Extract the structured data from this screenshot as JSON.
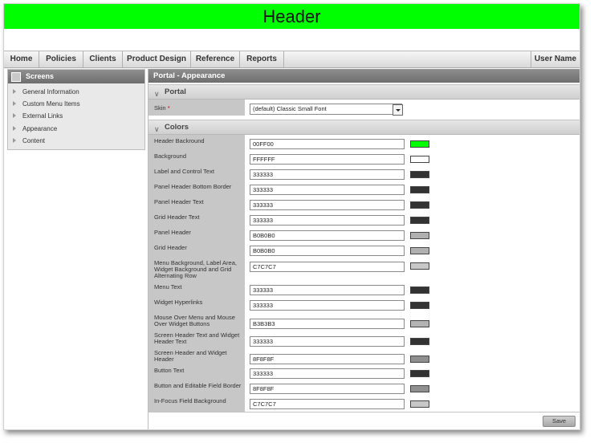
{
  "banner": {
    "title": "Header"
  },
  "nav": {
    "items": [
      "Home",
      "Policies",
      "Clients",
      "Product Design",
      "Reference",
      "Reports"
    ],
    "user": "User Name"
  },
  "sidebar": {
    "title": "Screens",
    "items": [
      "General Information",
      "Custom Menu Items",
      "External Links",
      "Appearance",
      "Content"
    ]
  },
  "main": {
    "title": "Portal - Appearance",
    "portal_section": "Portal",
    "skin_label": "Skin",
    "skin_value": "(default) Classic Small Font",
    "colors_section": "Colors",
    "save_label": "Save"
  },
  "colors": [
    {
      "label": "Header Backround",
      "value": "00FF00",
      "swatch": "#00ff00"
    },
    {
      "label": "Background",
      "value": "FFFFFF",
      "swatch": "#ffffff"
    },
    {
      "label": "Label and Control Text",
      "value": "333333",
      "swatch": "#333333"
    },
    {
      "label": "Panel Header Bottom Border",
      "value": "333333",
      "swatch": "#333333"
    },
    {
      "label": "Panel Header Text",
      "value": "333333",
      "swatch": "#333333"
    },
    {
      "label": "Grid Header Text",
      "value": "333333",
      "swatch": "#333333"
    },
    {
      "label": "Panel Header",
      "value": "B0B0B0",
      "swatch": "#b0b0b0"
    },
    {
      "label": "Grid Header",
      "value": "B0B0B0",
      "swatch": "#b0b0b0"
    },
    {
      "label": "Menu Background, Label Area, Widget Background and Grid Alternating Row",
      "value": "C7C7C7",
      "swatch": "#c7c7c7"
    },
    {
      "label": "Menu Text",
      "value": "333333",
      "swatch": "#333333"
    },
    {
      "label": "Widget Hyperlinks",
      "value": "333333",
      "swatch": "#333333"
    },
    {
      "label": "Mouse Over Menu and Mouse Over Widget Buttons",
      "value": "B3B3B3",
      "swatch": "#b3b3b3"
    },
    {
      "label": "Screen Header Text and Widget Header Text",
      "value": "333333",
      "swatch": "#333333"
    },
    {
      "label": "Screen Header and Widget Header",
      "value": "8F8F8F",
      "swatch": "#8f8f8f"
    },
    {
      "label": "Button Text",
      "value": "333333",
      "swatch": "#333333"
    },
    {
      "label": "Button and Editable Field Border",
      "value": "8F8F8F",
      "swatch": "#8f8f8f"
    },
    {
      "label": "In-Focus Field Background",
      "value": "C7C7C7",
      "swatch": "#c7c7c7"
    }
  ]
}
